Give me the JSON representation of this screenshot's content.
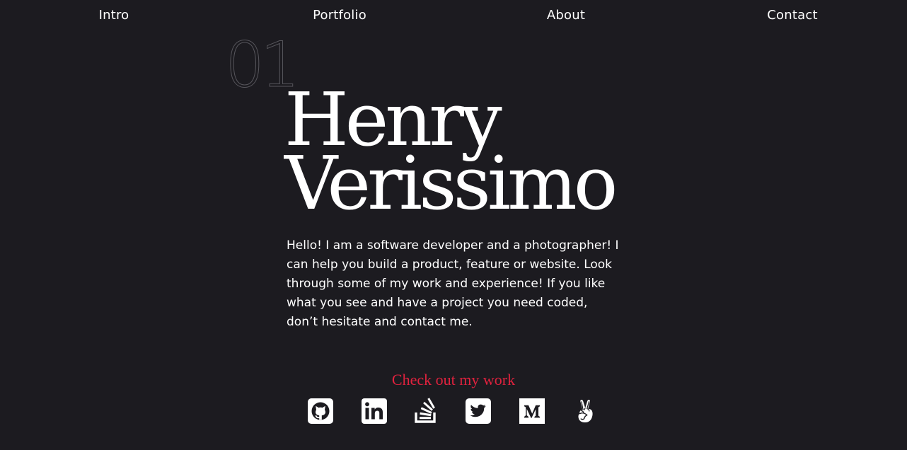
{
  "nav": {
    "items": [
      {
        "label": "Intro"
      },
      {
        "label": "Portfolio"
      },
      {
        "label": "About"
      },
      {
        "label": "Contact"
      }
    ]
  },
  "hero": {
    "section_number": "01",
    "name_line1": "Henry",
    "name_line2": "Verissimo",
    "bio": "Hello! I am a software developer and a photographer! I can help you build a product, feature or website. Look through some of my work and experience! If you like what you see and have a project you need coded, don’t hesitate and contact me.",
    "cta": "Check out my work"
  },
  "socials": [
    {
      "icon": "github-icon"
    },
    {
      "icon": "linkedin-icon"
    },
    {
      "icon": "stackoverflow-icon"
    },
    {
      "icon": "twitter-icon"
    },
    {
      "icon": "medium-icon"
    },
    {
      "icon": "angellist-icon"
    }
  ],
  "colors": {
    "background": "#1c1b20",
    "text": "#ffffff",
    "accent": "#e0223e",
    "muted": "#57565c"
  }
}
